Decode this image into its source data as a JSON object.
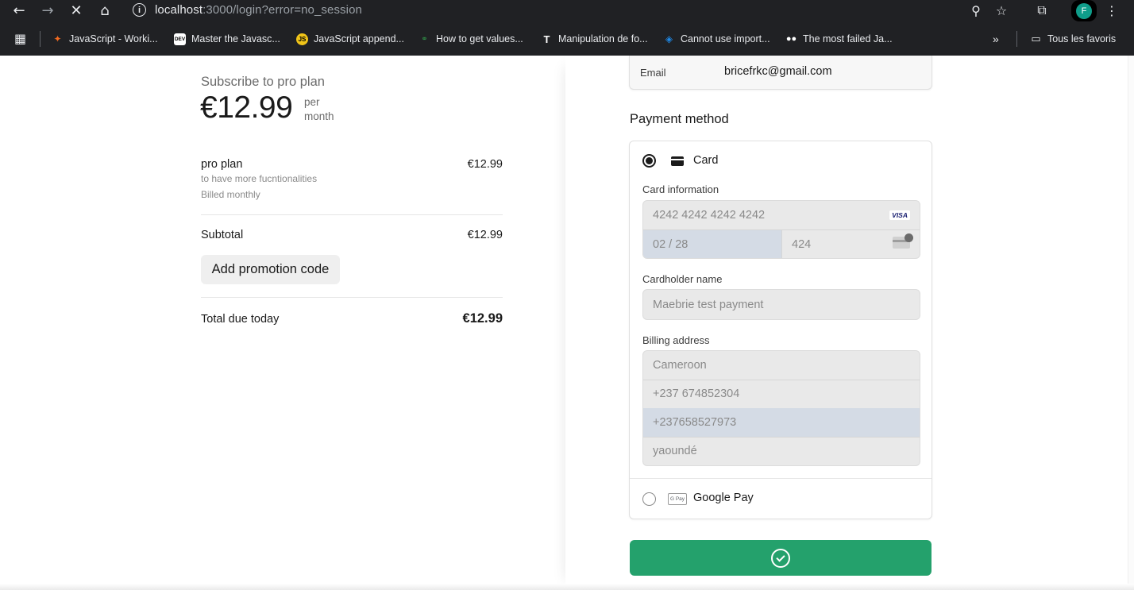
{
  "browser": {
    "url_host": "localhost",
    "url_rest": ":3000/login?error=no_session",
    "avatar_letter": "F",
    "bookmarks": [
      {
        "label": "JavaScript - Worki...",
        "icon": "fire-icon",
        "color": "#f26b21"
      },
      {
        "label": "Master the Javasc...",
        "icon": "dev-icon",
        "color": "#000000"
      },
      {
        "label": "JavaScript append...",
        "icon": "js-icon",
        "color": "#f0c419"
      },
      {
        "label": "How to get values...",
        "icon": "geeks-icon",
        "color": "#2f8d46"
      },
      {
        "label": "Manipulation de fo...",
        "icon": "t-icon",
        "color": "#ffffff"
      },
      {
        "label": "Cannot use import...",
        "icon": "stack-icon",
        "color": "#1e88e5"
      },
      {
        "label": "The most failed Ja...",
        "icon": "medium-icon",
        "color": "#ffffff"
      }
    ],
    "all_bookmarks": "Tous les favoris"
  },
  "summary": {
    "subscribe_title": "Subscribe to pro plan",
    "price": "€12.99",
    "per": "per",
    "period": "month",
    "item_name": "pro plan",
    "item_desc": "to have more fucntionalities",
    "item_billing": "Billed monthly",
    "item_price": "€12.99",
    "subtotal_label": "Subtotal",
    "subtotal_value": "€12.99",
    "promo_label": "Add promotion code",
    "total_label": "Total due today",
    "total_value": "€12.99"
  },
  "payment": {
    "email_label": "Email",
    "email_value": "bricefrkc@gmail.com",
    "method_title": "Payment method",
    "card_option": "Card",
    "card_info_label": "Card information",
    "card_number": "4242 4242 4242 4242",
    "card_brand": "VISA",
    "expiry": "02 / 28",
    "cvc": "424",
    "cardholder_label": "Cardholder name",
    "cardholder_value": "Maebrie test payment",
    "billing_label": "Billing address",
    "billing_country": "Cameroon",
    "billing_line1": "+237 674852304",
    "billing_line2": "+237658527973",
    "billing_city": "yaoundé",
    "gpay_icon_text": "G Pay",
    "gpay_option": "Google Pay",
    "accent": "#24a16c"
  }
}
